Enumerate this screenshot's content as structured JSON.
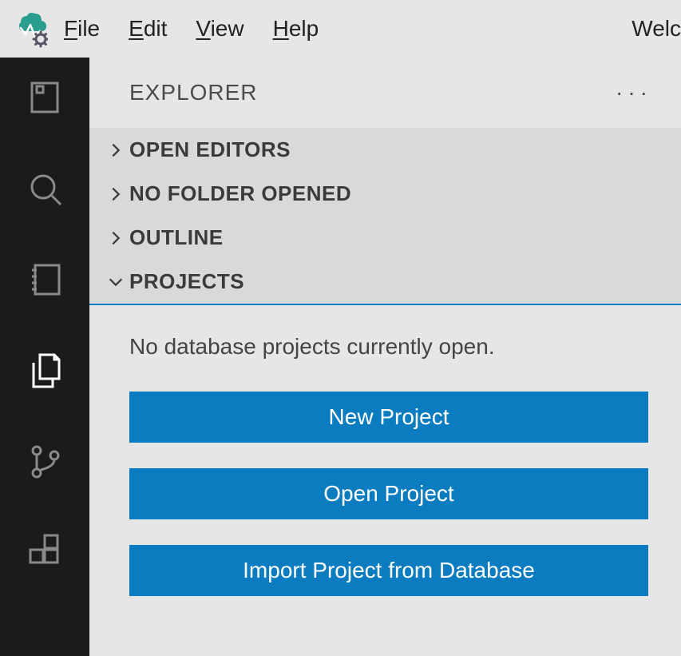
{
  "menubar": {
    "items": [
      {
        "label": "File",
        "mnemonic": "F"
      },
      {
        "label": "Edit",
        "mnemonic": "E"
      },
      {
        "label": "View",
        "mnemonic": "V"
      },
      {
        "label": "Help",
        "mnemonic": "H"
      }
    ],
    "right_partial": "Welc"
  },
  "activity_bar": {
    "items": [
      {
        "name": "servers",
        "icon": "server-icon",
        "active": false
      },
      {
        "name": "search",
        "icon": "search-icon",
        "active": false
      },
      {
        "name": "notebooks",
        "icon": "notebook-icon",
        "active": false
      },
      {
        "name": "explorer",
        "icon": "files-icon",
        "active": true
      },
      {
        "name": "source-control",
        "icon": "branch-icon",
        "active": false
      },
      {
        "name": "extensions",
        "icon": "extensions-icon",
        "active": false
      }
    ]
  },
  "sidebar": {
    "title": "EXPLORER",
    "more_label": "···",
    "sections": [
      {
        "label": "OPEN EDITORS",
        "expanded": false
      },
      {
        "label": "NO FOLDER OPENED",
        "expanded": false
      },
      {
        "label": "OUTLINE",
        "expanded": false
      },
      {
        "label": "PROJECTS",
        "expanded": true
      }
    ],
    "projects": {
      "empty_text": "No database projects currently open.",
      "buttons": {
        "new": "New Project",
        "open": "Open Project",
        "import": "Import Project from Database"
      }
    }
  },
  "colors": {
    "accent": "#0b7cc0",
    "activity_bg": "#1b1b1b",
    "section_bg": "#d9d9d9",
    "app_bg": "#e6e6e6"
  }
}
